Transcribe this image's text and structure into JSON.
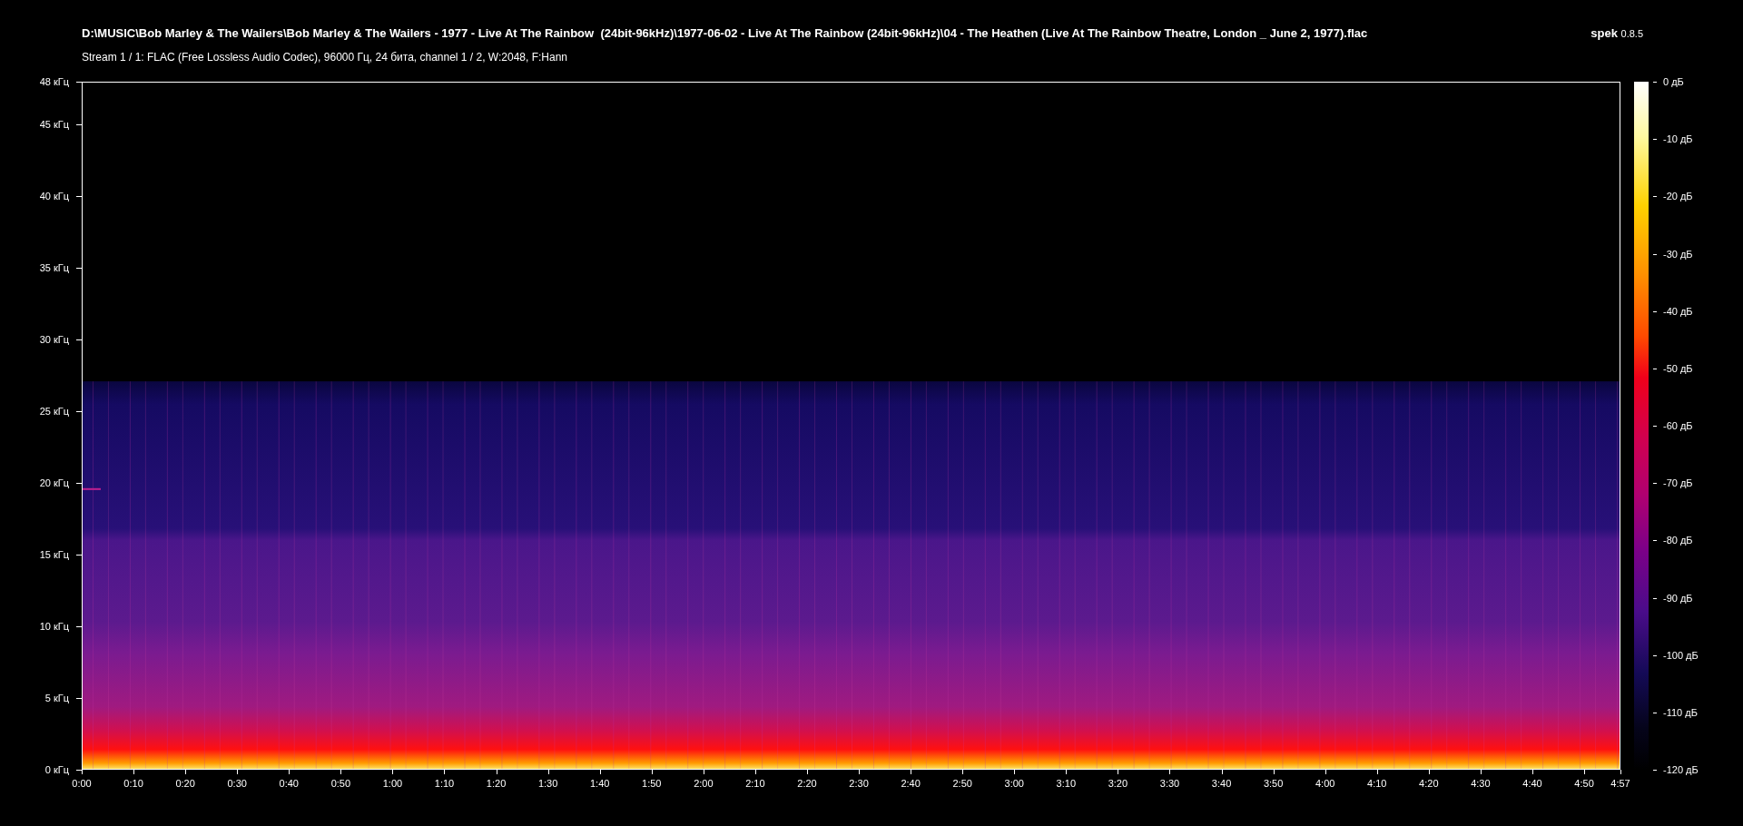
{
  "title": "D:\\MUSIC\\Bob Marley & The Wailers\\Bob Marley & The Wailers - 1977 - Live At The Rainbow  (24bit-96kHz)\\1977-06-02 - Live At The Rainbow (24bit-96kHz)\\04 - The Heathen (Live At The Rainbow Theatre, London _ June 2, 1977).flac",
  "stream_info": "Stream 1 / 1: FLAC (Free Lossless Audio Codec), 96000 Гц, 24 бита, channel 1 / 2, W:2048, F:Hann",
  "app": {
    "name": "spek",
    "version": "0.8.5"
  },
  "frequency_axis": {
    "labels": [
      "48 кГц",
      "45 кГц",
      "40 кГц",
      "35 кГц",
      "30 кГц",
      "25 кГц",
      "20 кГц",
      "15 кГц",
      "10 кГц",
      "5 кГц",
      "0 кГц"
    ]
  },
  "time_axis": {
    "labels": [
      "0:00",
      "0:10",
      "0:20",
      "0:30",
      "0:40",
      "0:50",
      "1:00",
      "1:10",
      "1:20",
      "1:30",
      "1:40",
      "1:50",
      "2:00",
      "2:10",
      "2:20",
      "2:30",
      "2:40",
      "2:50",
      "3:00",
      "3:10",
      "3:20",
      "3:30",
      "3:40",
      "3:50",
      "4:00",
      "4:10",
      "4:20",
      "4:30",
      "4:40",
      "4:50",
      "4:57"
    ]
  },
  "color_scale": {
    "labels": [
      "0 дБ",
      "-10 дБ",
      "-20 дБ",
      "-30 дБ",
      "-40 дБ",
      "-50 дБ",
      "-60 дБ",
      "-70 дБ",
      "-80 дБ",
      "-90 дБ",
      "-100 дБ",
      "-110 дБ",
      "-120 дБ"
    ]
  }
}
